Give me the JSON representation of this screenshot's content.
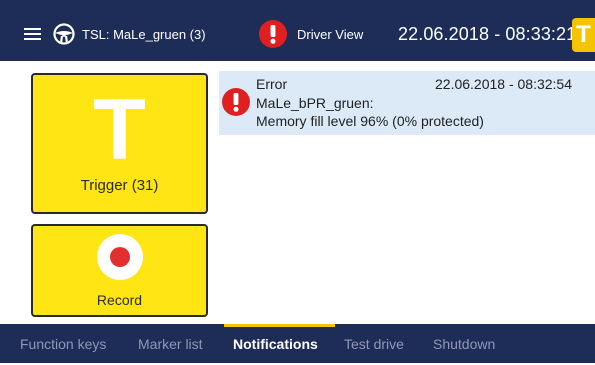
{
  "header": {
    "tsl_label": "TSL: MaLe_gruen (3)",
    "driver_view_label": "Driver View",
    "datetime": "22.06.2018 - 08:33:21",
    "trigger_mini_label": "T"
  },
  "actions": {
    "trigger_symbol": "T",
    "trigger_label": "Trigger (31)",
    "record_label": "Record"
  },
  "notifications": [
    {
      "type": "Error",
      "timestamp": "22.06.2018 - 08:32:54",
      "source": "MaLe_bPR_gruen:",
      "message": "Memory fill level 96% (0% protected)",
      "icon": "alert-icon"
    }
  ],
  "nav": {
    "tabs": [
      "Function keys",
      "Marker list",
      "Notifications",
      "Test drive",
      "Shutdown"
    ],
    "active_tab": "Notifications"
  },
  "colors": {
    "header_bg": "#1d2d57",
    "button_yellow": "#ffe514",
    "accent_yellow": "#f5c400",
    "alert_red": "#e02020",
    "notification_bg": "#dce9f7"
  }
}
